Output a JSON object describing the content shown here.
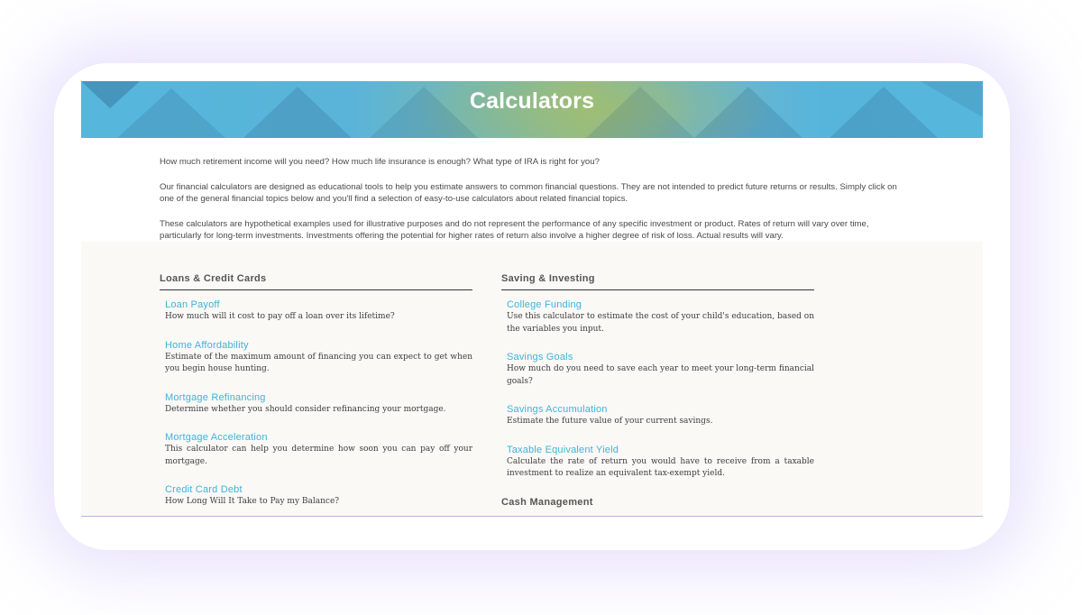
{
  "page": {
    "title": "Calculators"
  },
  "intro": {
    "paragraphs": [
      "How much retirement income will you need? How much life insurance is enough? What type of IRA is right for you?",
      "Our financial calculators are designed as educational tools to help you estimate answers to common financial questions. They are not intended to predict future returns or results. Simply click on one of the general financial topics below and you'll find a selection of easy-to-use calculators about related financial topics.",
      "These calculators are hypothetical examples used for illustrative purposes and do not represent the performance of any specific investment or product. Rates of return will vary over time, particularly for long-term investments. Investments offering the potential for higher rates of return also involve a higher degree of risk of loss. Actual results will vary."
    ]
  },
  "loans": {
    "title": "Loans & Credit Cards",
    "items": [
      {
        "label": "Loan Payoff",
        "desc": "How much will it cost to pay off a loan over its lifetime?"
      },
      {
        "label": "Home Affordability",
        "desc": "Estimate of the maximum amount of financing you can expect to get when you begin house hunting."
      },
      {
        "label": "Mortgage Refinancing",
        "desc": "Determine whether you should consider refinancing your mortgage."
      },
      {
        "label": "Mortgage Acceleration",
        "desc": "This calculator can help you determine how soon you can pay off your mortgage."
      },
      {
        "label": "Credit Card Debt",
        "desc": "How Long Will It Take to Pay my Balance?"
      }
    ]
  },
  "saving": {
    "title": "Saving & Investing",
    "items": [
      {
        "label": "College Funding",
        "desc": "Use this calculator to estimate the cost of your child's education, based on the variables you input."
      },
      {
        "label": "Savings Goals",
        "desc": "How much do you need to save each year to meet your long-term financial goals?"
      },
      {
        "label": "Savings Accumulation",
        "desc": "Estimate the future value of your current savings."
      },
      {
        "label": "Taxable Equivalent Yield",
        "desc": "Calculate the rate of return you would have to receive from a taxable investment to realize an equivalent tax-exempt yield."
      }
    ]
  },
  "cash": {
    "title": "Cash Management"
  },
  "colors": {
    "link": "#3db3db",
    "banner": "#56b6dc"
  }
}
